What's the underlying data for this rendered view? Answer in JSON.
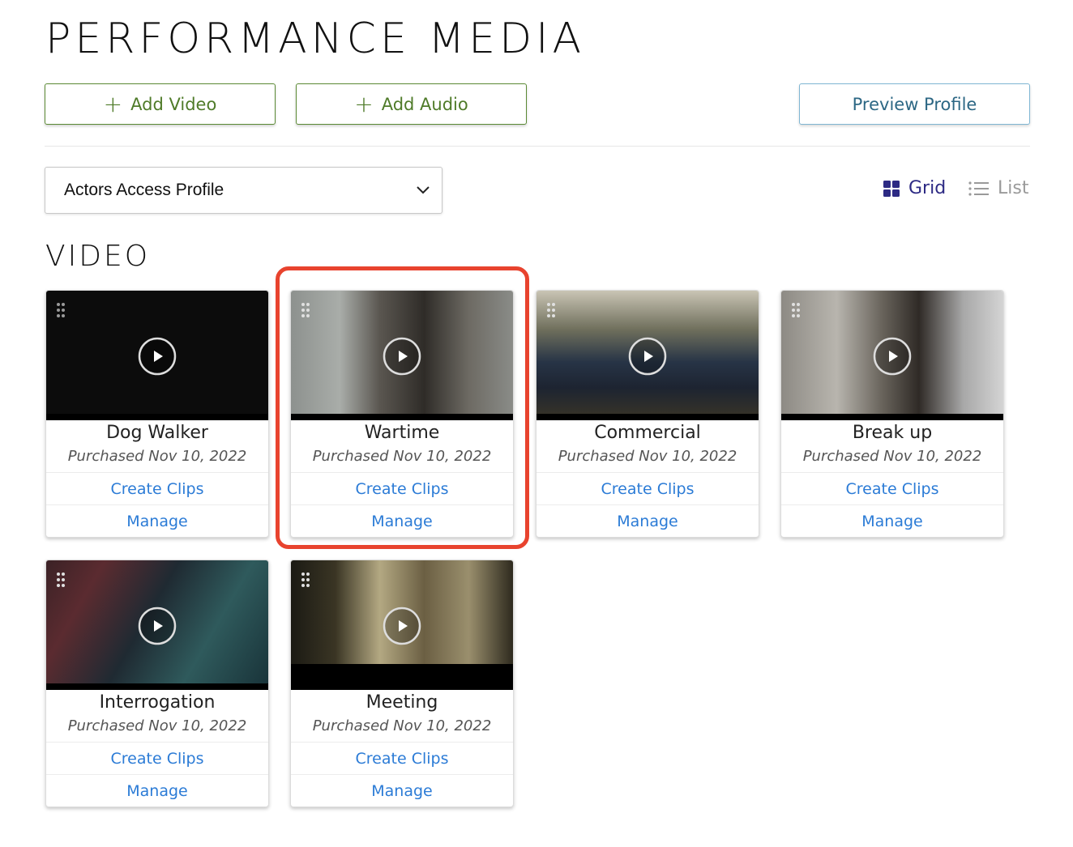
{
  "page": {
    "title": "PERFORMANCE MEDIA"
  },
  "actions": {
    "add_video": "Add Video",
    "add_audio": "Add Audio",
    "preview_profile": "Preview Profile"
  },
  "profile_select": {
    "selected": "Actors Access Profile"
  },
  "view": {
    "grid_label": "Grid",
    "list_label": "List",
    "active": "Grid"
  },
  "section": {
    "title": "VIDEO"
  },
  "videos": [
    {
      "title": "Dog Walker",
      "date": "Purchased Nov 10, 2022",
      "create_clips": "Create Clips",
      "manage": "Manage"
    },
    {
      "title": "Wartime",
      "date": "Purchased Nov 10, 2022",
      "create_clips": "Create Clips",
      "manage": "Manage"
    },
    {
      "title": "Commercial",
      "date": "Purchased Nov 10, 2022",
      "create_clips": "Create Clips",
      "manage": "Manage"
    },
    {
      "title": "Break up",
      "date": "Purchased Nov 10, 2022",
      "create_clips": "Create Clips",
      "manage": "Manage"
    },
    {
      "title": "Interrogation",
      "date": "Purchased Nov 10, 2022",
      "create_clips": "Create Clips",
      "manage": "Manage"
    },
    {
      "title": "Meeting",
      "date": "Purchased Nov 10, 2022",
      "create_clips": "Create Clips",
      "manage": "Manage"
    }
  ],
  "colors": {
    "green_button": "#4f7b29",
    "blue_button": "#2c6784",
    "link": "#2b7bd6",
    "grid_active": "#2d2a84",
    "highlight": "#e8432e"
  }
}
